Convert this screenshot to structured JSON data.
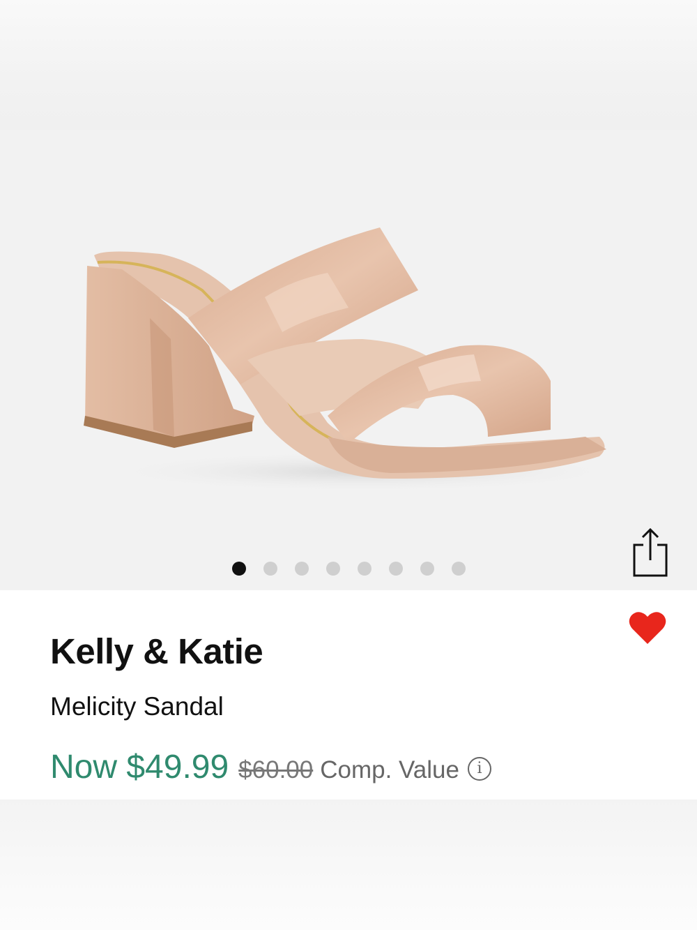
{
  "product": {
    "brand": "Kelly & Katie",
    "name": "Melicity Sandal",
    "now_price": "Now $49.99",
    "original_price": "$60.00",
    "comp_value_label": "Comp. Value",
    "info_glyph": "i"
  },
  "gallery": {
    "image_count": 8,
    "active_index": 0
  },
  "icons": {
    "share": "share-icon",
    "favorite": "heart-icon",
    "info": "info-icon"
  },
  "colors": {
    "price_green": "#2f8a6e",
    "heart_red": "#e8261c",
    "sandal_nude": "#e2b9a0"
  }
}
